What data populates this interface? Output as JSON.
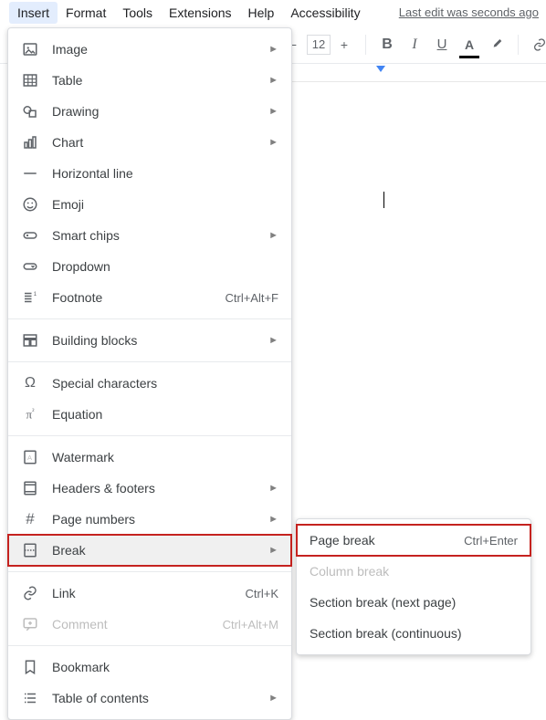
{
  "menubar": {
    "items": [
      "Insert",
      "Format",
      "Tools",
      "Extensions",
      "Help",
      "Accessibility"
    ],
    "active_index": 0,
    "last_edit": "Last edit was seconds ago"
  },
  "toolbar": {
    "font_size": "12"
  },
  "insert_menu": {
    "sections": [
      [
        {
          "icon": "image-icon",
          "label": "Image",
          "submenu": true
        },
        {
          "icon": "table-icon",
          "label": "Table",
          "submenu": true
        },
        {
          "icon": "drawing-icon",
          "label": "Drawing",
          "submenu": true
        },
        {
          "icon": "chart-icon",
          "label": "Chart",
          "submenu": true
        },
        {
          "icon": "hline-icon",
          "label": "Horizontal line"
        },
        {
          "icon": "emoji-icon",
          "label": "Emoji"
        },
        {
          "icon": "smartchips-icon",
          "label": "Smart chips",
          "submenu": true
        },
        {
          "icon": "dropdown-icon",
          "label": "Dropdown"
        },
        {
          "icon": "footnote-icon",
          "label": "Footnote",
          "shortcut": "Ctrl+Alt+F"
        }
      ],
      [
        {
          "icon": "blocks-icon",
          "label": "Building blocks",
          "submenu": true
        }
      ],
      [
        {
          "icon": "omega-icon",
          "label": "Special characters"
        },
        {
          "icon": "equation-icon",
          "label": "Equation"
        }
      ],
      [
        {
          "icon": "watermark-icon",
          "label": "Watermark"
        },
        {
          "icon": "headers-icon",
          "label": "Headers & footers",
          "submenu": true
        },
        {
          "icon": "pagenum-icon",
          "label": "Page numbers",
          "submenu": true
        },
        {
          "icon": "break-icon",
          "label": "Break",
          "submenu": true,
          "highlight": true
        }
      ],
      [
        {
          "icon": "link-icon",
          "label": "Link",
          "shortcut": "Ctrl+K"
        },
        {
          "icon": "comment-icon",
          "label": "Comment",
          "shortcut": "Ctrl+Alt+M",
          "disabled": true
        }
      ],
      [
        {
          "icon": "bookmark-icon",
          "label": "Bookmark"
        },
        {
          "icon": "toc-icon",
          "label": "Table of contents",
          "submenu": true
        }
      ]
    ]
  },
  "break_submenu": {
    "items": [
      {
        "label": "Page break",
        "shortcut": "Ctrl+Enter",
        "highlight": true
      },
      {
        "label": "Column break",
        "disabled": true
      },
      {
        "label": "Section break (next page)"
      },
      {
        "label": "Section break (continuous)"
      }
    ]
  }
}
